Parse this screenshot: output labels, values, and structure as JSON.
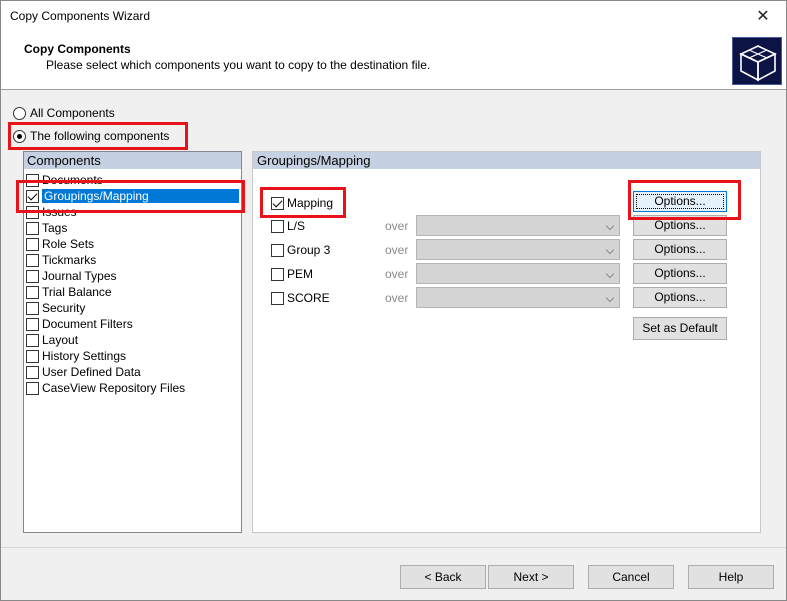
{
  "window": {
    "title": "Copy Components Wizard"
  },
  "header": {
    "title": "Copy Components",
    "subtitle": "Please select which components you want to copy to the destination file."
  },
  "scope": {
    "all_label": "All Components",
    "following_label": "The following components",
    "selected": "following"
  },
  "components": {
    "header": "Components",
    "items": [
      {
        "label": "Documents",
        "checked": false
      },
      {
        "label": "Groupings/Mapping",
        "checked": true,
        "selected": true
      },
      {
        "label": "Issues",
        "checked": false
      },
      {
        "label": "Tags",
        "checked": false
      },
      {
        "label": "Role Sets",
        "checked": false
      },
      {
        "label": "Tickmarks",
        "checked": false
      },
      {
        "label": "Journal Types",
        "checked": false
      },
      {
        "label": "Trial Balance",
        "checked": false
      },
      {
        "label": "Security",
        "checked": false
      },
      {
        "label": "Document Filters",
        "checked": false
      },
      {
        "label": "Layout",
        "checked": false
      },
      {
        "label": "History Settings",
        "checked": false
      },
      {
        "label": "User Defined Data",
        "checked": false
      },
      {
        "label": "CaseView Repository Files",
        "checked": false
      }
    ]
  },
  "groupings": {
    "header": "Groupings/Mapping",
    "over_label": "over",
    "rows": [
      {
        "label": "Mapping",
        "checked": true,
        "options_label": "Options..."
      },
      {
        "label": "L/S",
        "checked": false,
        "options_label": "Options..."
      },
      {
        "label": "Group 3",
        "checked": false,
        "options_label": "Options..."
      },
      {
        "label": "PEM",
        "checked": false,
        "options_label": "Options..."
      },
      {
        "label": "SCORE",
        "checked": false,
        "options_label": "Options..."
      }
    ],
    "set_default_label": "Set as Default"
  },
  "footer": {
    "back_label": "< Back",
    "next_label": "Next >",
    "cancel_label": "Cancel",
    "help_label": "Help"
  },
  "colors": {
    "highlight": "#e8121b",
    "selection": "#0078d7",
    "panel_header": "#c5d1e2"
  }
}
